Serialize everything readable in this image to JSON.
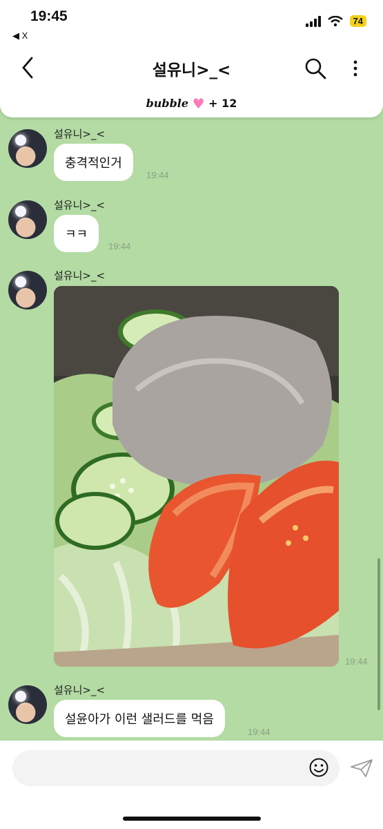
{
  "status": {
    "time": "19:45",
    "back_app": "◀ X",
    "battery": "74"
  },
  "header": {
    "title": "설유니>_<",
    "bubble_brand": "bubble",
    "bubble_count": "+ 12"
  },
  "messages": [
    {
      "sender": "설유니>_<",
      "text": "충격적인거",
      "time": "19:44"
    },
    {
      "sender": "설유니>_<",
      "text": "ㅋㅋ",
      "time": "19:44"
    },
    {
      "sender": "설유니>_<",
      "image": "salad-photo",
      "time": "19:44"
    },
    {
      "sender": "설유니>_<",
      "text": "설윤아가 이런 샐러드를 먹음",
      "time": "19:44"
    }
  ],
  "colors": {
    "chat_background": "#b3dba3",
    "bubble": "#ffffff",
    "battery": "#f4d21b",
    "heart": "#ff7ab8"
  },
  "icons": [
    "back-icon",
    "search-icon",
    "more-icon",
    "heart-icon",
    "emoji-icon",
    "send-icon"
  ]
}
